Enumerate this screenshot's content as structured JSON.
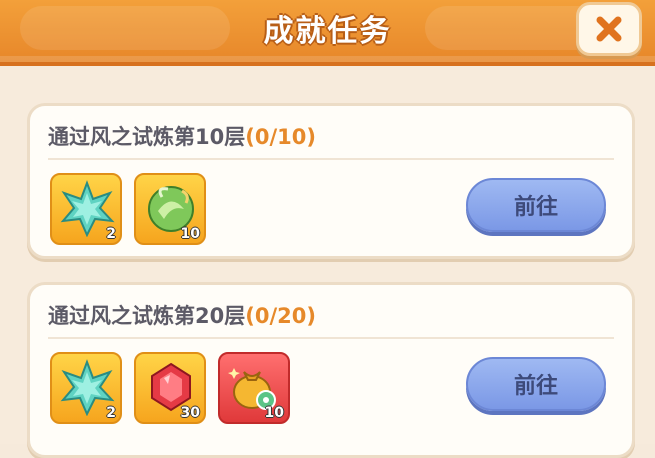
{
  "header": {
    "title": "成就任务",
    "close_icon": "close-icon"
  },
  "tasks": [
    {
      "title": "通过风之试炼第10层",
      "progress": "(0/10)",
      "go_label": "前往",
      "rewards": [
        {
          "icon": "green-star-shard-icon",
          "count": "2"
        },
        {
          "icon": "wind-orb-icon",
          "count": "10"
        }
      ]
    },
    {
      "title": "通过风之试炼第20层",
      "progress": "(0/20)",
      "go_label": "前往",
      "rewards": [
        {
          "icon": "green-star-shard-icon",
          "count": "2"
        },
        {
          "icon": "red-gem-icon",
          "count": "30"
        },
        {
          "icon": "gold-pouch-icon",
          "count": "10"
        }
      ]
    }
  ],
  "colors": {
    "header": "#e7872a",
    "progress": "#e6892a",
    "button": "#8aa7ec"
  }
}
